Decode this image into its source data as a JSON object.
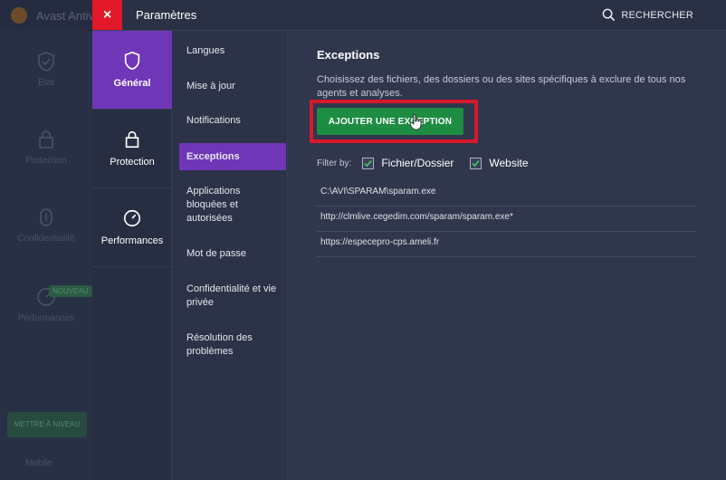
{
  "background_app": {
    "title": "Avast Antiv",
    "nav": [
      "État",
      "Protection",
      "Confidentialité",
      "Performances"
    ],
    "badge": "NOUVEAU",
    "upgrade_label": "METTRE À NIVEAU",
    "mobile_label": "Mobile"
  },
  "modal": {
    "close_symbol": "×",
    "title": "Paramètres",
    "search_label": "RECHERCHER"
  },
  "categories": [
    {
      "label": "Général",
      "icon": "shield-icon",
      "active": true
    },
    {
      "label": "Protection",
      "icon": "lock-icon",
      "active": false
    },
    {
      "label": "Performances",
      "icon": "gauge-icon",
      "active": false
    }
  ],
  "subnav": [
    {
      "label": "Langues"
    },
    {
      "label": "Mise à jour"
    },
    {
      "label": "Notifications"
    },
    {
      "label": "Exceptions",
      "active": true
    },
    {
      "label": "Applications bloquées et autorisées"
    },
    {
      "label": "Mot de passe"
    },
    {
      "label": "Confidentialité et vie privée"
    },
    {
      "label": "Résolution des problèmes"
    }
  ],
  "content": {
    "title": "Exceptions",
    "description": "Choisissez des fichiers, des dossiers ou des sites spécifiques à exclure de tous nos agents et analyses.",
    "add_button_label": "AJOUTER UNE EXCEPTION",
    "filter_label": "Filter by:",
    "filters": [
      {
        "label": "Fichier/Dossier",
        "checked": true
      },
      {
        "label": "Website",
        "checked": true
      }
    ],
    "exceptions": [
      "C:\\AVI\\SPARAM\\sparam.exe",
      "http://clmlive.cegedim.com/sparam/sparam.exe*",
      "https://especepro-cps.ameli.fr"
    ]
  },
  "colors": {
    "accent_purple": "#6f36b8",
    "close_red": "#e2172a",
    "button_green": "#1f8c43",
    "highlight_red": "#d7192b"
  }
}
